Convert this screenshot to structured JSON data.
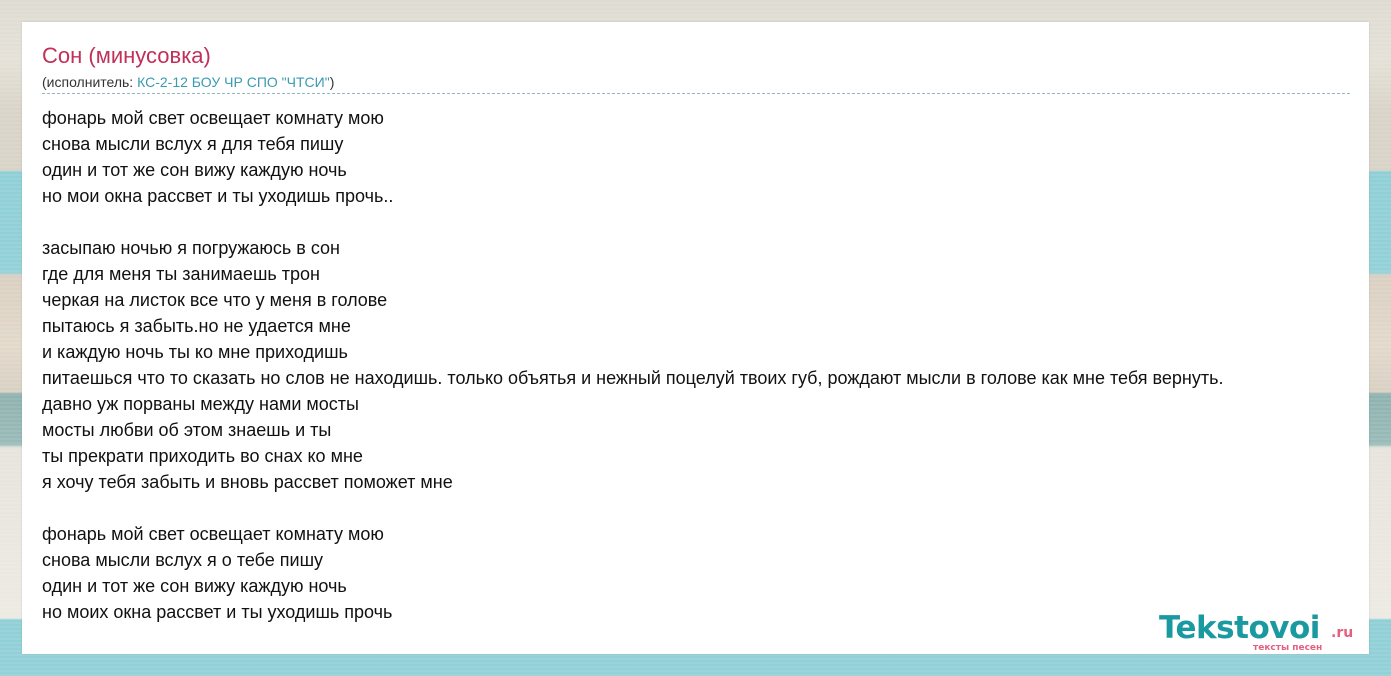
{
  "song": {
    "title": "Сон (минусовка)",
    "artist_prefix": "(исполнитель: ",
    "artist_name": "КС-2-12 БОУ ЧР СПО \"ЧТСИ\"",
    "artist_suffix": ")"
  },
  "lyrics": [
    "фонарь мой свет освещает комнату мою",
    "снова мысли вслух я для тебя пишу",
    "один и тот же сон вижу каждую ночь",
    "но мои окна рассвет и ты уходишь прочь..",
    "",
    "засыпаю ночью я погружаюсь в сон",
    "где для меня ты занимаешь трон",
    "черкая на листок все что у меня в голове",
    "пытаюсь я забыть.но не удается мне",
    "и каждую ночь ты ко мне приходишь",
    "питаешься что то сказать но слов не находишь. только объятья и нежный поцелуй твоих губ, рождают мысли в голове как мне тебя вернуть.",
    "давно уж порваны между нами мосты",
    "мосты любви об этом знаешь и ты",
    "ты прекрати приходить во снах ко мне",
    "я хочу тебя забыть и вновь рассвет поможет мне",
    "",
    "фонарь мой свет освещает комнату мою",
    "снова мысли вслух я о тебе пишу",
    "один и тот же сон вижу каждую ночь",
    "но моих окна рассвет и ты уходишь прочь"
  ],
  "logo": {
    "main": "Tekstovoi",
    "domain": ".ru",
    "tagline": "тексты песен"
  },
  "colors": {
    "title": "#c0305a",
    "link": "#3a9bb0",
    "logo": "#1a9aa0",
    "logo_accent": "#e46080"
  }
}
